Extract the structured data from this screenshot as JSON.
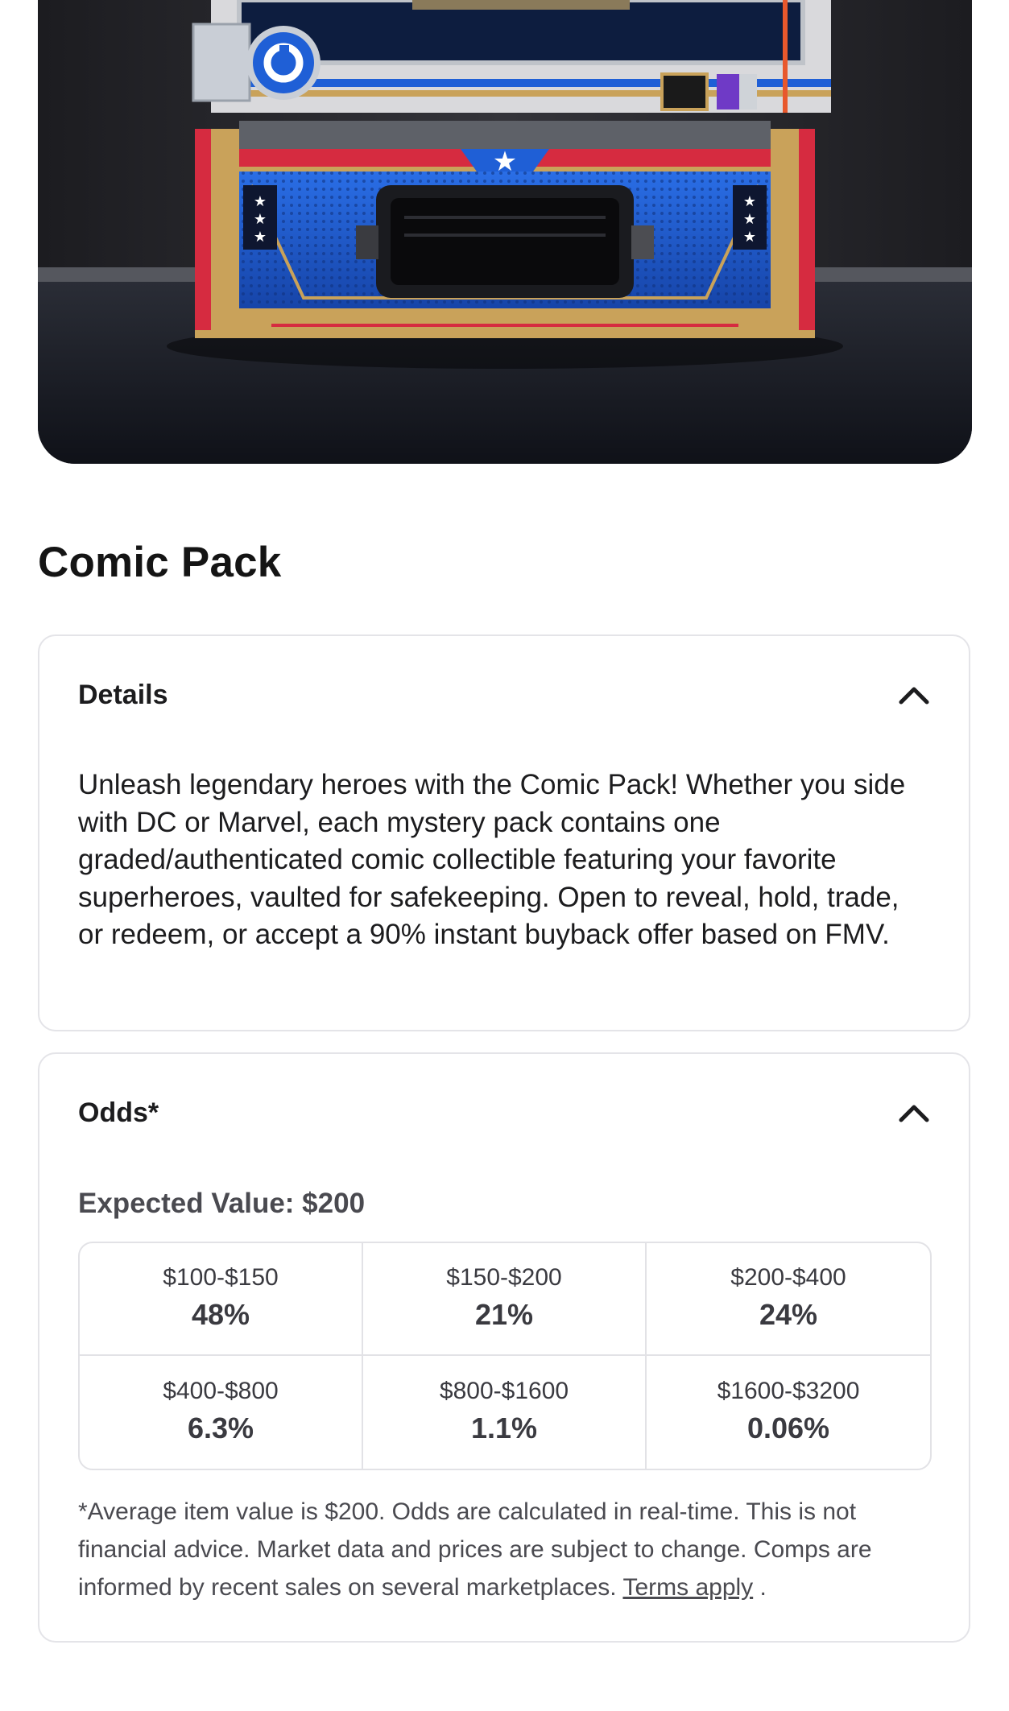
{
  "product": {
    "title": "Comic Pack"
  },
  "details": {
    "header_label": "Details",
    "toggle_icon": "chevron-up-icon",
    "description": "Unleash legendary heroes with the Comic Pack! Whether you side with DC or Marvel, each mystery pack contains one graded/authenticated comic collectible featuring your favorite superheroes, vaulted for safekeeping. Open to reveal, hold, trade, or redeem, or accept a 90% instant buyback offer based on FMV."
  },
  "odds": {
    "header_label": "Odds*",
    "toggle_icon": "chevron-up-icon",
    "expected_value": "Expected Value: $200",
    "tiers": [
      {
        "range": "$100-$150",
        "percent": "48%"
      },
      {
        "range": "$150-$200",
        "percent": "21%"
      },
      {
        "range": "$200-$400",
        "percent": "24%"
      },
      {
        "range": "$400-$800",
        "percent": "6.3%"
      },
      {
        "range": "$800-$1600",
        "percent": "1.1%"
      },
      {
        "range": "$1600-$3200",
        "percent": "0.06%"
      }
    ],
    "disclaimer_text": "*Average item value is $200. Odds are calculated in real-time. This is not financial advice. Market data and prices are subject to change. Comps are informed by recent sales on several marketplaces.",
    "terms_link": "Terms apply",
    "disclaimer_end": "."
  },
  "colors": {
    "card_border": "#e4e4e8",
    "text_primary": "#1c1c1e",
    "text_secondary": "#4a4a50",
    "machine_blue": "#1f5fd6",
    "machine_red": "#d62b40",
    "machine_gold": "#c9a25a"
  }
}
